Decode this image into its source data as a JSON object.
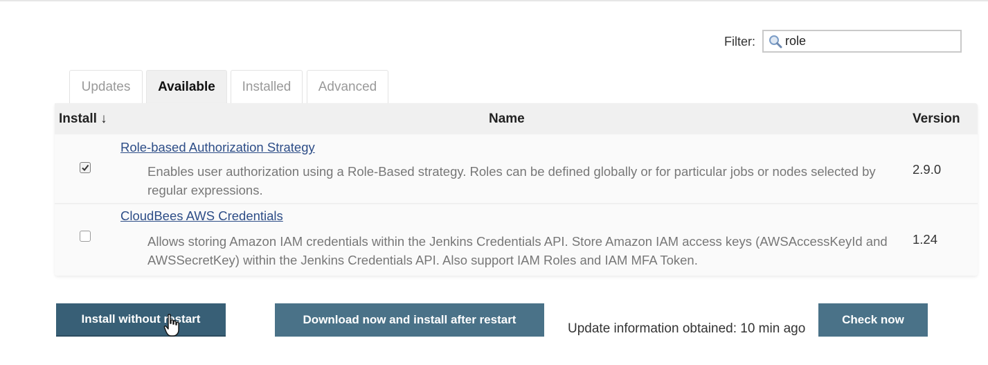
{
  "filter": {
    "label": "Filter:",
    "value": "role",
    "icon": "magnifier-icon"
  },
  "tabs": [
    {
      "label": "Updates",
      "active": false
    },
    {
      "label": "Available",
      "active": true
    },
    {
      "label": "Installed",
      "active": false
    },
    {
      "label": "Advanced",
      "active": false
    }
  ],
  "table": {
    "headers": {
      "install": "Install ↓",
      "name": "Name",
      "version": "Version"
    },
    "rows": [
      {
        "checked": true,
        "name": "Role-based Authorization Strategy",
        "description": "Enables user authorization using a Role-Based strategy. Roles can be defined globally or for particular jobs or nodes selected by regular expressions.",
        "version": "2.9.0"
      },
      {
        "checked": false,
        "name": "CloudBees AWS Credentials",
        "description": "Allows storing Amazon IAM credentials within the Jenkins Credentials API. Store Amazon IAM access keys (AWSAccessKeyId and AWSSecretKey) within the Jenkins Credentials API. Also support IAM Roles and IAM MFA Token.",
        "version": "1.24"
      }
    ]
  },
  "buttons": {
    "install_without_restart": "Install without restart",
    "download_and_install": "Download now and install after restart",
    "check_now": "Check now"
  },
  "update_info": "Update information obtained: 10 min ago",
  "colors": {
    "button": "#4a7288",
    "button_dark": "#385f76",
    "link": "#2d4d87"
  }
}
